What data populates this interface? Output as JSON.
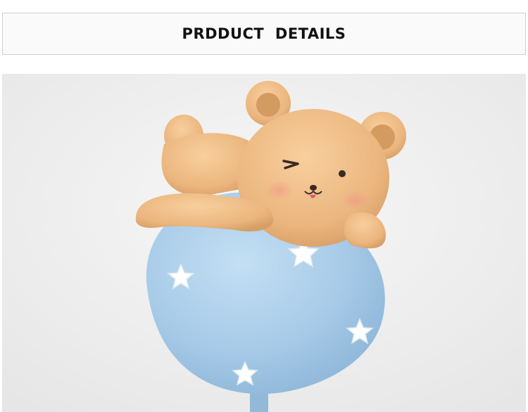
{
  "header": {
    "title": "PRDDUCT  DETAILS"
  },
  "product_image": {
    "subject": "bear-on-balloon-figurine",
    "colors": {
      "background": "#efefef",
      "bear": "#eebc86",
      "balloon": "#a9cdea",
      "stars": "#ffffff"
    }
  }
}
